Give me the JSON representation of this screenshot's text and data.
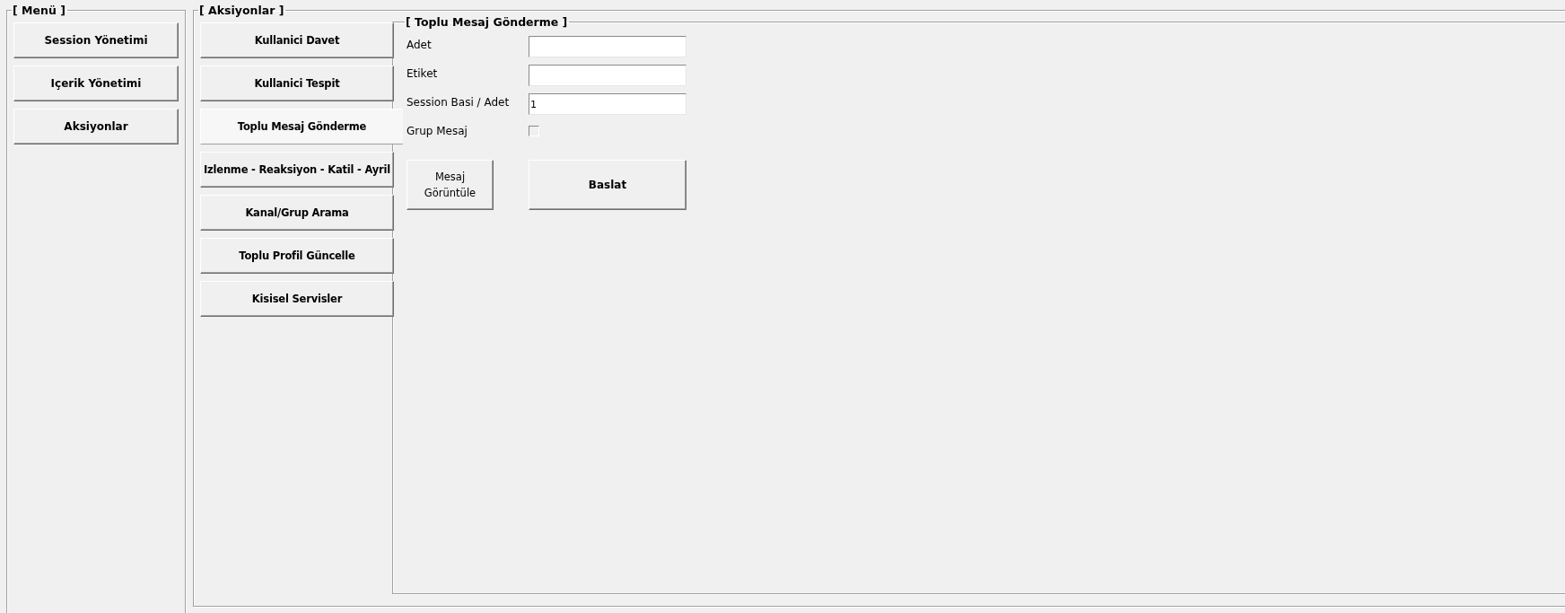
{
  "menu": {
    "title": "[ Menü ]",
    "items": [
      {
        "label": "Session Yönetimi"
      },
      {
        "label": "Içerik Yönetimi"
      },
      {
        "label": "Aksiyonlar"
      }
    ]
  },
  "actions": {
    "title": "[ Aksiyonlar ]",
    "items": [
      {
        "label": "Kullanici Davet",
        "selected": false
      },
      {
        "label": "Kullanici Tespit",
        "selected": false
      },
      {
        "label": "Toplu Mesaj Gönderme",
        "selected": true
      },
      {
        "label": "Izlenme - Reaksiyon - Katil - Ayril",
        "selected": false
      },
      {
        "label": "Kanal/Grup Arama",
        "selected": false
      },
      {
        "label": "Toplu Profil Güncelle",
        "selected": false
      },
      {
        "label": "Kisisel Servisler",
        "selected": false
      }
    ]
  },
  "panel": {
    "title": "[ Toplu Mesaj Gönderme ]",
    "fields": [
      {
        "kind": "text",
        "label": "Adet"
      },
      {
        "kind": "text",
        "label": "Etiket"
      },
      {
        "kind": "text",
        "label": "Session Basi / Adet",
        "value": "1"
      },
      {
        "kind": "checkbox",
        "label": "Grup Mesaj",
        "checked": false
      }
    ],
    "buttons": [
      {
        "label": "Mesaj Görüntüle"
      },
      {
        "label": "Baslat"
      }
    ]
  }
}
